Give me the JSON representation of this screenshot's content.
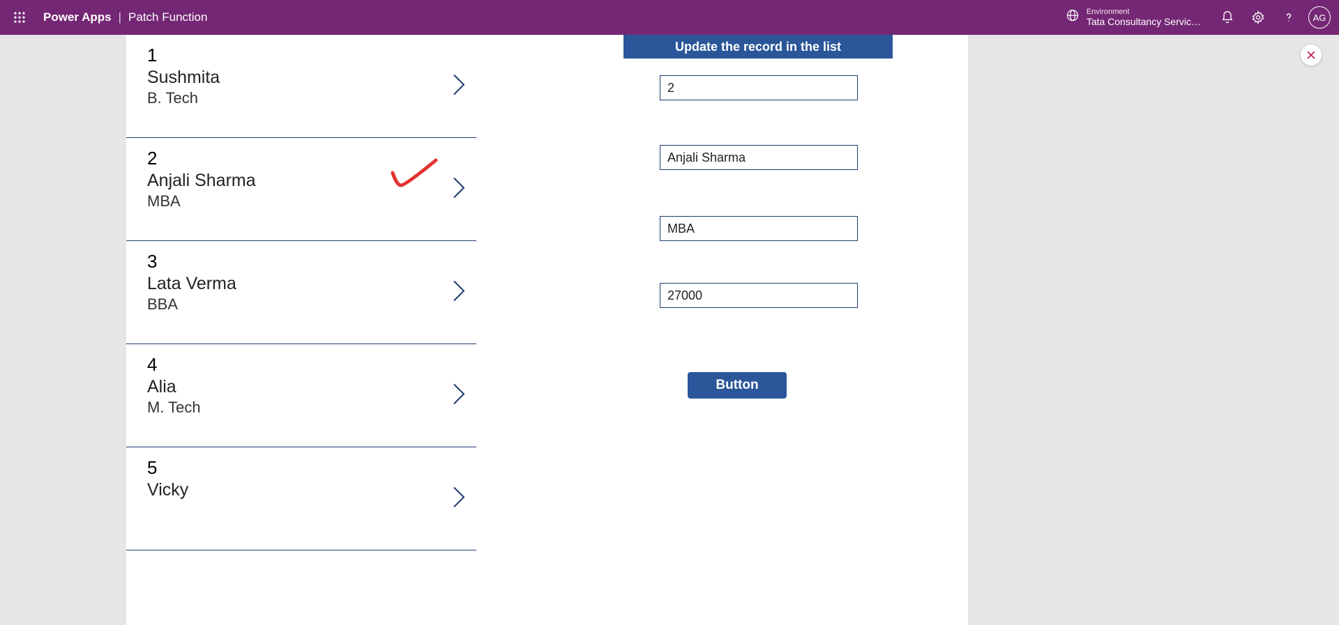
{
  "header": {
    "app_name": "Power Apps",
    "separator": "|",
    "page_name": "Patch Function",
    "env_label": "Environment",
    "env_name": "Tata Consultancy Servic…",
    "avatar_initials": "AG"
  },
  "gallery": [
    {
      "id": "1",
      "name": "Sushmita",
      "degree": "B. Tech",
      "selected": false
    },
    {
      "id": "2",
      "name": "Anjali Sharma",
      "degree": "MBA",
      "selected": true
    },
    {
      "id": "3",
      "name": "Lata Verma",
      "degree": "BBA",
      "selected": false
    },
    {
      "id": "4",
      "name": "Alia",
      "degree": "M. Tech",
      "selected": false
    },
    {
      "id": "5",
      "name": "Vicky",
      "degree": "",
      "selected": false
    }
  ],
  "form": {
    "title": "Update the record in the list",
    "id_value": "2",
    "name_value": "Anjali Sharma",
    "degree_value": "MBA",
    "salary_value": "27000",
    "button_label": "Button"
  }
}
